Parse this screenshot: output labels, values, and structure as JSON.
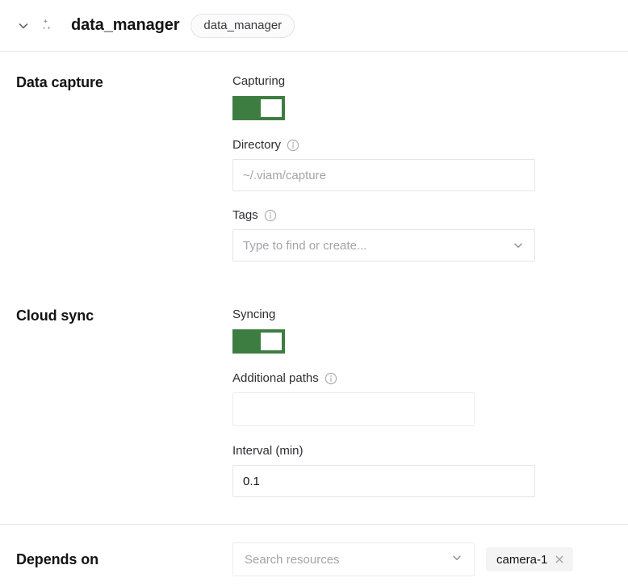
{
  "header": {
    "collapse_icon": "chevron-down-icon",
    "type_icon": "sparkle-stars-icon",
    "title": "data_manager",
    "name_pill": "data_manager"
  },
  "sections": [
    {
      "label": "Data capture",
      "fields": {
        "capturing_label": "Capturing",
        "capturing_on": true,
        "directory_label": "Directory",
        "directory_info_icon": "info-circle-icon",
        "directory_value": "",
        "directory_placeholder": "~/.viam/capture",
        "tags_label": "Tags",
        "tags_info_icon": "info-circle-icon",
        "tags_placeholder": "Type to find or create...",
        "tags_caret_icon": "chevron-down-icon"
      }
    },
    {
      "label": "Cloud sync",
      "fields": {
        "syncing_label": "Syncing",
        "syncing_on": true,
        "additional_paths_label": "Additional paths",
        "additional_paths_info_icon": "info-circle-icon",
        "additional_paths_value": "",
        "interval_label": "Interval (min)",
        "interval_value": "0.1"
      }
    }
  ],
  "depends_on": {
    "label": "Depends on",
    "search_placeholder": "Search resources",
    "search_caret_icon": "chevron-down-icon",
    "chips": [
      {
        "label": "camera-1",
        "remove_icon": "close-x-icon"
      }
    ]
  },
  "colors": {
    "toggle_on": "#3e7d41",
    "border": "#e4e4e7",
    "placeholder": "#a3a3ab",
    "text": "#131314",
    "chip_bg": "#f4f4f5"
  }
}
